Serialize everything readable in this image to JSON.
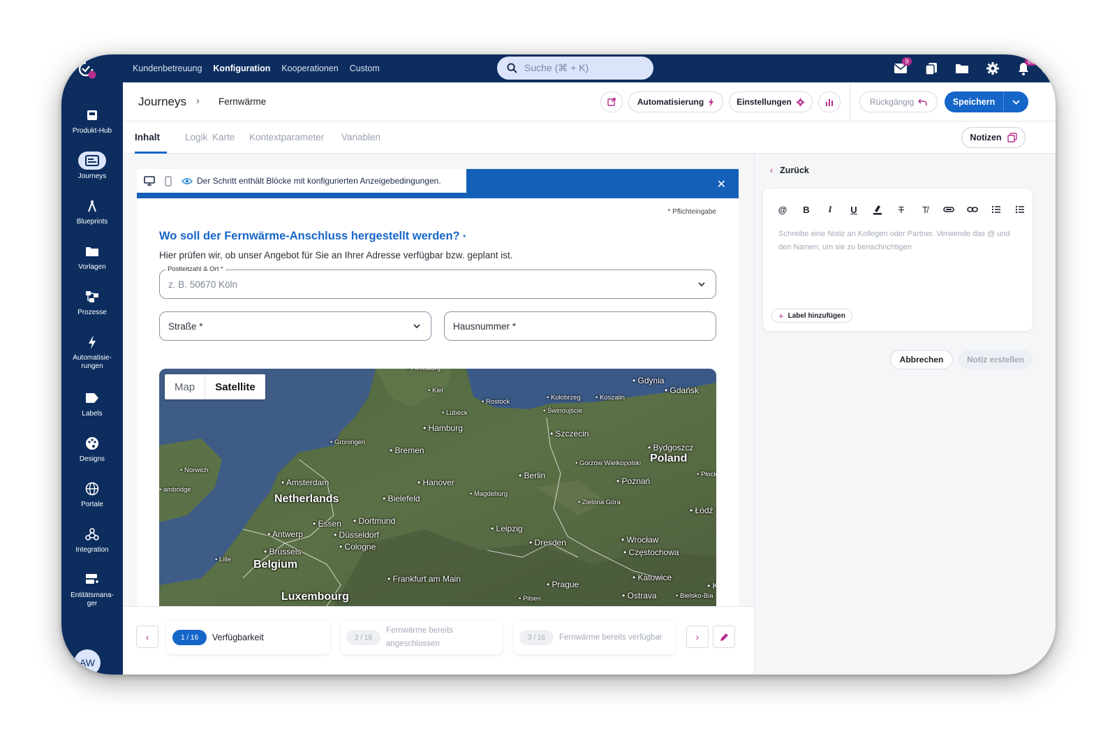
{
  "topnav": {
    "items": [
      "Kundenbetreuung",
      "Konfiguration",
      "Kooperationen",
      "Custom"
    ],
    "active_index": 1,
    "search_placeholder": "Suche (⌘ + K)",
    "mail_badge": "9",
    "notifications_badge": "68"
  },
  "sidebar": {
    "items": [
      {
        "label": "Produkt-Hub",
        "icon": "product-hub-icon"
      },
      {
        "label": "Journeys",
        "icon": "journeys-icon"
      },
      {
        "label": "Blueprints",
        "icon": "compass-icon"
      },
      {
        "label": "Vorlagen",
        "icon": "folder-icon"
      },
      {
        "label": "Prozesse",
        "icon": "process-icon"
      },
      {
        "label": "Automatisie-rungen",
        "icon": "lightning-icon"
      },
      {
        "label": "Labels",
        "icon": "tag-icon"
      },
      {
        "label": "Designs",
        "icon": "palette-icon"
      },
      {
        "label": "Portale",
        "icon": "globe-icon"
      },
      {
        "label": "Integration",
        "icon": "webhook-icon"
      },
      {
        "label": "Entitätsmana-ger",
        "icon": "entity-icon"
      }
    ],
    "active_index": 1,
    "avatar_initials": "AW"
  },
  "header": {
    "breadcrumb_root": "Journeys",
    "breadcrumb_current": "Fernwärme",
    "automation_label": "Automatisierung",
    "settings_label": "Einstellungen",
    "undo_label": "Rückgängig",
    "save_label": "Speichern"
  },
  "tabs": {
    "items": [
      "Inhalt",
      "Logik",
      "Karte",
      "Kontextparameter",
      "Variablen"
    ],
    "active_index": 0,
    "notes_label": "Notizen"
  },
  "form": {
    "info_text": "Der Schritt enthält Blöcke mit konfigurierten Anzeigebedingungen.",
    "required_note": "* Pflichteingabe",
    "question_title": "Wo soll der Fernwärme-Anschluss hergestellt werden?",
    "question_subtitle": "Hier prüfen wir, ob unser Angebot für Sie an Ihrer Adresse verfügbar bzw. geplant ist.",
    "postal_legend": "Postleitzahl & Ort *",
    "postal_placeholder": "z. B. 50670 Köln",
    "street_label": "Straße *",
    "house_number_label": "Hausnummer *"
  },
  "map": {
    "toggle_map": "Map",
    "toggle_satellite": "Satellite",
    "mode": "satellite",
    "labels": [
      {
        "text": "Flensburg",
        "kind": "small"
      },
      {
        "text": "Kiel",
        "kind": "small"
      },
      {
        "text": "Rostock",
        "kind": "small"
      },
      {
        "text": "Kołobrzeg",
        "kind": "small"
      },
      {
        "text": "Koszalin",
        "kind": "small"
      },
      {
        "text": "Gdynia",
        "kind": "city"
      },
      {
        "text": "Gdańsk",
        "kind": "city"
      },
      {
        "text": "Lübeck",
        "kind": "small"
      },
      {
        "text": "Świnoujście",
        "kind": "small"
      },
      {
        "text": "Hamburg",
        "kind": "city"
      },
      {
        "text": "Szczecin",
        "kind": "city"
      },
      {
        "text": "Groningen",
        "kind": "small"
      },
      {
        "text": "Bremen",
        "kind": "city"
      },
      {
        "text": "Bydgoszcz",
        "kind": "city"
      },
      {
        "text": "Poland",
        "kind": "country"
      },
      {
        "text": "Norwich",
        "kind": "small"
      },
      {
        "text": "Gorzów Wielkopolski",
        "kind": "small"
      },
      {
        "text": "Berlin",
        "kind": "city"
      },
      {
        "text": "Amsterdam",
        "kind": "city"
      },
      {
        "text": "Hanover",
        "kind": "city"
      },
      {
        "text": "Poznań",
        "kind": "city"
      },
      {
        "text": "Płock",
        "kind": "small"
      },
      {
        "text": "ambridge",
        "kind": "small"
      },
      {
        "text": "Netherlands",
        "kind": "country"
      },
      {
        "text": "Bielefeld",
        "kind": "city"
      },
      {
        "text": "Magdeburg",
        "kind": "small"
      },
      {
        "text": "Zielona Góra",
        "kind": "small"
      },
      {
        "text": "Łódź",
        "kind": "city"
      },
      {
        "text": "Essen",
        "kind": "city"
      },
      {
        "text": "Dortmund",
        "kind": "city"
      },
      {
        "text": "Antwerp",
        "kind": "city"
      },
      {
        "text": "Düsseldorf",
        "kind": "city"
      },
      {
        "text": "Leipzig",
        "kind": "city"
      },
      {
        "text": "Cologne",
        "kind": "city"
      },
      {
        "text": "Dresden",
        "kind": "city"
      },
      {
        "text": "Wrocław",
        "kind": "city"
      },
      {
        "text": "Brussels",
        "kind": "city"
      },
      {
        "text": "Częstochowa",
        "kind": "city"
      },
      {
        "text": "Lille",
        "kind": "small"
      },
      {
        "text": "Belgium",
        "kind": "country"
      },
      {
        "text": "Frankfurt am Main",
        "kind": "city"
      },
      {
        "text": "Katowice",
        "kind": "city"
      },
      {
        "text": "Prague",
        "kind": "city"
      },
      {
        "text": "Kr",
        "kind": "city"
      },
      {
        "text": "Luxembourg",
        "kind": "country"
      },
      {
        "text": "Ostrava",
        "kind": "city"
      },
      {
        "text": "Bielsko-Bia",
        "kind": "small"
      },
      {
        "text": "Pilsen",
        "kind": "small"
      }
    ]
  },
  "steps": [
    {
      "counter": "1 / 16",
      "title": "Verfügbarkeit",
      "active": true
    },
    {
      "counter": "2 / 16",
      "title": "Fernwärme bereits angeschlossen",
      "active": false
    },
    {
      "counter": "3 / 16",
      "title": "Fernwärme bereits verfügbar",
      "active": false
    }
  ],
  "notes_panel": {
    "back_label": "Zurück",
    "toolbar_icons": [
      "at-icon",
      "bold-icon",
      "italic-icon",
      "underline-icon",
      "highlight-icon",
      "strikethrough-icon",
      "clear-format-icon",
      "attachment-icon",
      "link-icon",
      "ordered-list-icon",
      "bullet-list-icon"
    ],
    "placeholder": "Schreibe eine Notiz an Kollegen oder Partner. Verwende das @ und den Namen, um sie zu benachrichtigen",
    "add_label": "Label hinzufügen",
    "cancel_label": "Abbrechen",
    "create_label": "Notiz erstellen"
  },
  "colors": {
    "nav_bg": "#0c2d5e",
    "primary": "#1666c9",
    "accent": "#b62e8f",
    "info_bar": "#1460b8"
  }
}
